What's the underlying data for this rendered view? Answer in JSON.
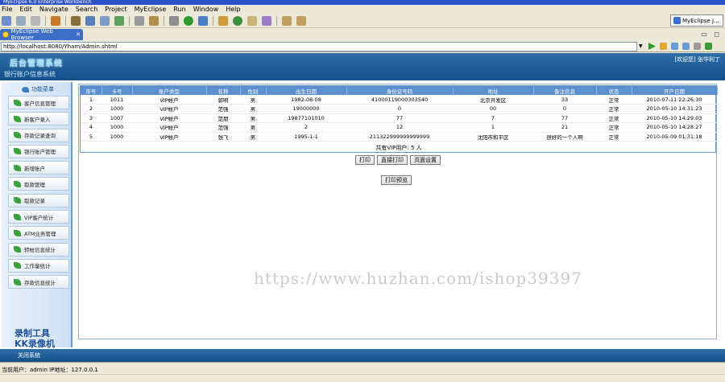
{
  "ide": {
    "title": "MyEclipse 6.0 Enterprise Workbench",
    "menus": [
      "File",
      "Edit",
      "Navigate",
      "Search",
      "Project",
      "MyEclipse",
      "Run",
      "Window",
      "Help"
    ],
    "perspective_label": "MyEclipse J...",
    "tab_label": "MyEclipse Web Browser",
    "tab_close": "✕",
    "url": "http://localhost:8080/Yham/Admin.shtml",
    "colors": {
      "accent": "#2b52c9",
      "chrome": "#ece9d8"
    }
  },
  "app": {
    "logo": "后台管理系统",
    "subtitle": "银行账户信息系统",
    "welcome": "[欢迎您] 张华利丁",
    "sidebar_head": "功能菜单",
    "sidebar_items": [
      "客户信息管理",
      "新客户录入",
      "存款记录查询",
      "银行账户管理",
      "新增账户",
      "取款管理",
      "取款记录",
      "VIP客户统计",
      "ATM业务管理",
      "转帐信息统计",
      "工作量统计",
      "存款信息统计"
    ],
    "table": {
      "headers": [
        "序号",
        "卡号",
        "账户类型",
        "名称",
        "性别",
        "出生日期",
        "身份证号码",
        "地址",
        "备注信息",
        "状态",
        "开户日期"
      ],
      "rows": [
        [
          "1",
          "1011",
          "VIP帐户",
          "郭明",
          "男",
          "1982-08-08",
          "41000119000303540",
          "北京开发区",
          "33",
          "正常",
          "2010-07-11 22:26:30"
        ],
        [
          "2",
          "1000",
          "VIP帐户",
          "范强",
          "男",
          "19000000",
          "0",
          "00",
          "0",
          "正常",
          "2010-05-10 14:31:23"
        ],
        [
          "3",
          "1007",
          "VIP帐户",
          "范朋",
          "男",
          "19877101010",
          "77",
          "7",
          "77",
          "正常",
          "2010-05-10 14:29:03"
        ],
        [
          "4",
          "1000",
          "VIP帐户",
          "范强",
          "男",
          "2",
          "12",
          "1",
          "21",
          "正常",
          "2010-05-10 14:28:27"
        ],
        [
          "5",
          "1000",
          "VIP帐户",
          "张飞",
          "男",
          "1995-1-1",
          "211322999999999999",
          "沈阳市和平区",
          "很好的一个人啊",
          "正常",
          "2010-05-09 01:31:18"
        ]
      ],
      "total": "共有VIP用户: 5 人"
    },
    "buttons": {
      "print": "打印",
      "direct_print": "直接打印",
      "page_setup": "页面设置",
      "preview": "打印预览"
    },
    "watermark_side": [
      "录制工具",
      "KK录像机"
    ],
    "watermark_url": "https://www.huzhan.com/ishop39397",
    "logout": "关闭系统",
    "colors": {
      "header": "#2e6ea8",
      "grid_header": "#5b8fcf"
    }
  },
  "status": {
    "text": "当前用户：admin  IP地址：127.0.0.1"
  }
}
